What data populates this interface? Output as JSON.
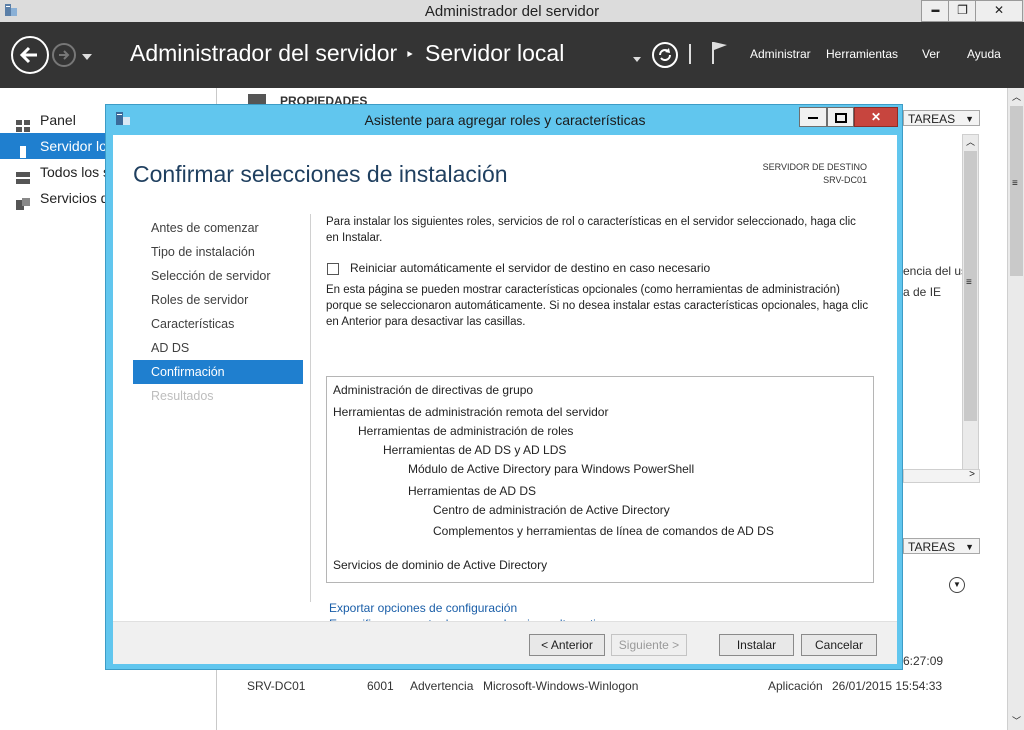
{
  "window": {
    "title": "Administrador del servidor",
    "controls": {
      "minimize": "▬",
      "maximize": "❐",
      "close": "✕"
    }
  },
  "header": {
    "breadcrumb_app": "Administrador del servidor",
    "breadcrumb_sep": "‣",
    "breadcrumb_page": "Servidor local",
    "menu": [
      "Administrar",
      "Herramientas",
      "Ver",
      "Ayuda"
    ],
    "icons": [
      "back-arrow-icon",
      "forward-arrow-icon",
      "dropdown-icon",
      "refresh-icon",
      "flag-icon"
    ]
  },
  "sidebar": {
    "items": [
      {
        "label": "Panel",
        "icon": "dashboard-icon"
      },
      {
        "label": "Servidor local",
        "icon": "server-icon",
        "selected": true
      },
      {
        "label": "Todos los servidores",
        "icon": "servers-icon"
      },
      {
        "label": "Servicios de archivos y de almacenamiento",
        "icon": "storage-icon"
      }
    ]
  },
  "background": {
    "properties_label": "PROPIEDADES",
    "tasks_label": "TAREAS",
    "side_text_1": "encia del us",
    "side_text_2": "a de IE",
    "partial_time": "6:27:09",
    "event_row": {
      "server": "SRV-DC01",
      "id": "6001",
      "level": "Advertencia",
      "source": "Microsoft-Windows-Winlogon",
      "log": "Aplicación",
      "date": "26/01/2015 15:54:33"
    }
  },
  "dialog": {
    "title": "Asistente para agregar roles y características",
    "heading": "Confirmar selecciones de instalación",
    "dest_label": "SERVIDOR DE DESTINO",
    "dest_server": "SRV-DC01",
    "steps": [
      {
        "label": "Antes de comenzar",
        "state": "normal"
      },
      {
        "label": "Tipo de instalación",
        "state": "normal"
      },
      {
        "label": "Selección de servidor",
        "state": "normal"
      },
      {
        "label": "Roles de servidor",
        "state": "normal"
      },
      {
        "label": "Características",
        "state": "normal"
      },
      {
        "label": "AD DS",
        "state": "normal"
      },
      {
        "label": "Confirmación",
        "state": "active"
      },
      {
        "label": "Resultados",
        "state": "disabled"
      }
    ],
    "intro_line1": "Para instalar los siguientes roles, servicios de rol o características en el servidor seleccionado, haga clic",
    "intro_line2": "en Instalar.",
    "restart_checkbox": "Reiniciar automáticamente el servidor de destino en caso necesario",
    "restart_checked": false,
    "note_line1": "En esta página se pueden mostrar características opcionales (como herramientas de administración)",
    "note_line2": "porque se seleccionaron automáticamente. Si no desea instalar estas características opcionales, haga clic",
    "note_line3": "en Anterior para desactivar las casillas.",
    "features": [
      {
        "label": "Administración de directivas de grupo",
        "level": 0
      },
      {
        "label": "Herramientas de administración remota del servidor",
        "level": 0
      },
      {
        "label": "Herramientas de administración de roles",
        "level": 1
      },
      {
        "label": "Herramientas de AD DS y AD LDS",
        "level": 2
      },
      {
        "label": "Módulo de Active Directory para Windows PowerShell",
        "level": 3
      },
      {
        "label": "Herramientas de AD DS",
        "level": 3
      },
      {
        "label": "Centro de administración de Active Directory",
        "level": 4
      },
      {
        "label": "Complementos y herramientas de línea de comandos de AD DS",
        "level": 4
      },
      {
        "label": "Servicios de dominio de Active Directory",
        "level": 0
      }
    ],
    "link_export": "Exportar opciones de configuración",
    "link_source": "Especifique una ruta de acceso de origen alternativa",
    "buttons": {
      "previous": "< Anterior",
      "next": "Siguiente >",
      "install": "Instalar",
      "cancel": "Cancelar"
    }
  }
}
